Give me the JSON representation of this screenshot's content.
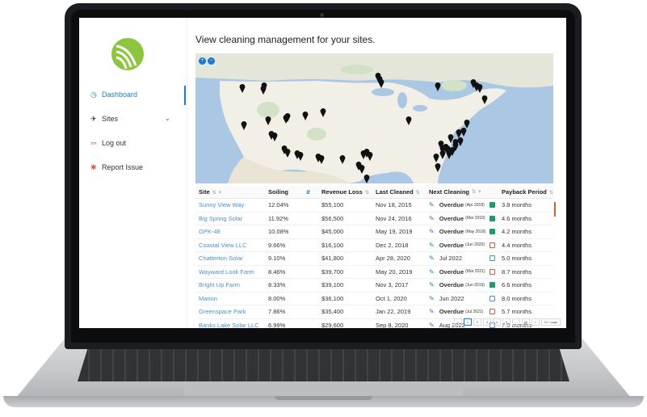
{
  "sidebar": {
    "items": [
      {
        "label": "Dashboard",
        "icon": "dashboard-icon",
        "active": true
      },
      {
        "label": "Sites",
        "icon": "pin-icon",
        "has_submenu": true
      },
      {
        "label": "Log out",
        "icon": "logout-icon"
      },
      {
        "label": "Report Issue",
        "icon": "bug-icon"
      }
    ]
  },
  "main": {
    "title": "View cleaning management for your sites.",
    "map": {
      "zoom_in": "+",
      "zoom_out": "−"
    }
  },
  "table": {
    "columns": [
      "Site",
      "Soiling",
      "Revenue Loss",
      "Last Cleaned",
      "Next Cleaning",
      "Payback Period"
    ],
    "rows": [
      {
        "site": "Sunny View Way",
        "soiling": "12.04%",
        "loss": "$55,100",
        "last": "Nov 18, 2015",
        "next": "Overdue",
        "next_note": "(Apr 2018)",
        "payback": "3.8 months",
        "cal": "green"
      },
      {
        "site": "Big Spring Solar",
        "soiling": "11.92%",
        "loss": "$56,500",
        "last": "Nov 24, 2016",
        "next": "Overdue",
        "next_note": "(Mar 2019)",
        "payback": "4.6 months",
        "cal": "green"
      },
      {
        "site": "GPK-48",
        "soiling": "10.08%",
        "loss": "$45,000",
        "last": "May 19, 2019",
        "next": "Overdue",
        "next_note": "(May 2018)",
        "payback": "4.2 months",
        "cal": "green"
      },
      {
        "site": "Coastal View LLC",
        "soiling": "9.66%",
        "loss": "$16,100",
        "last": "Dec 2, 2018",
        "next": "Overdue",
        "next_note": "(Jun 2020)",
        "payback": "4.4 months",
        "cal": "red"
      },
      {
        "site": "Chatterton Solar",
        "soiling": "9.10%",
        "loss": "$41,800",
        "last": "Apr 28, 2020",
        "next": "Jul 2022",
        "next_note": "",
        "payback": "5.0 months",
        "cal": "blue"
      },
      {
        "site": "Wayward Look Farm",
        "soiling": "8.46%",
        "loss": "$39,700",
        "last": "May 20, 2019",
        "next": "Overdue",
        "next_note": "(Mar 2021)",
        "payback": "8.7 months",
        "cal": "red"
      },
      {
        "site": "Bright Up Farm",
        "soiling": "8.33%",
        "loss": "$39,100",
        "last": "Nov 3, 2017",
        "next": "Overdue",
        "next_note": "(Jun 2019)",
        "payback": "6.6 months",
        "cal": "green"
      },
      {
        "site": "Marion",
        "soiling": "8.00%",
        "loss": "$36,100",
        "last": "Oct 1, 2020",
        "next": "Jun 2022",
        "next_note": "",
        "payback": "8.0 months",
        "cal": "blue"
      },
      {
        "site": "Greenspace Park",
        "soiling": "7.86%",
        "loss": "$35,400",
        "last": "Jan 22, 2019",
        "next": "Overdue",
        "next_note": "(Jul 2021)",
        "payback": "5.7 months",
        "cal": "red"
      },
      {
        "site": "Banks Lake Solar LLC",
        "soiling": "6.99%",
        "loss": "$29,600",
        "last": "Sep 8, 2020",
        "next": "Aug 2022",
        "next_note": "",
        "payback": "7.9 months",
        "cal": "blue"
      }
    ]
  },
  "pagination": {
    "pages": [
      "<",
      "1",
      "2",
      "3",
      "4",
      "5",
      "...",
      "20",
      ">"
    ],
    "current": "1",
    "page_size": "10 / page"
  },
  "colors": {
    "accent": "#1e7ad9",
    "logo": "#8cc63f",
    "danger": "#e05a3a",
    "ok": "#1a9c6c",
    "link": "#4a90d9"
  }
}
